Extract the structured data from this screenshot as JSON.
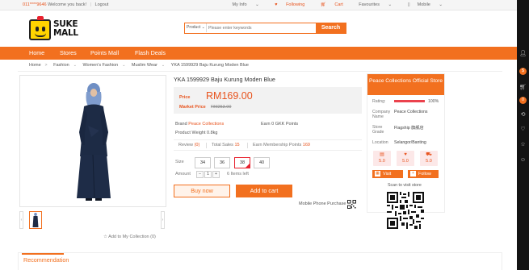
{
  "topbar": {
    "phone": "011****9646",
    "welcome": "Welcome you back!",
    "logout": "Logout",
    "my_info": "My Info",
    "following": "Following",
    "cart": "Cart",
    "favourites": "Favourites",
    "mobile": "Mobile"
  },
  "logo": {
    "line1": "SUKE",
    "line2": "MALL"
  },
  "search": {
    "category": "Product",
    "placeholder": "Please enter keywords",
    "button": "Search"
  },
  "nav": [
    "Home",
    "Stores",
    "Points Mall",
    "Flash Deals"
  ],
  "breadcrumb": [
    "Home",
    "Fashion",
    "Women's Fashion",
    "Muslim Wear",
    "YKA 1599929 Baju Kurung Moden Blue"
  ],
  "product": {
    "title": "YKA 1599929 Baju Kurung Moden Blue",
    "price_label": "Price",
    "price": "RM169.00",
    "market_label": "Market Price",
    "market_price": "RM253.00",
    "brand_label": "Brand",
    "brand": "Peace Collections",
    "points": "Earn 0 GKK Points",
    "weight": "Product Weight 0.8kg",
    "review_label": "Review",
    "review_count": "(0)",
    "sales_label": "Total Sales",
    "sales_count": "15",
    "membership_label": "Earn Membership Points",
    "membership_points": "169",
    "size_label": "Size",
    "sizes": [
      "34",
      "36",
      "38",
      "40"
    ],
    "selected_size": "38",
    "amount_label": "Amount",
    "amount": "1",
    "minus": "−",
    "plus": "+",
    "items_left": "6 Items left",
    "buy_now": "Buy now",
    "add_to_cart": "Add to cart",
    "mobile_purchase": "Mobile Phone Purchase",
    "add_collection": "Add to My Collection (0)"
  },
  "store": {
    "title": "Peace Collections Official Store",
    "rating_label": "Rating:",
    "rating": "100%",
    "company_label": "Company Name",
    "company": "Peace Collections",
    "grade_label": "Store Grade",
    "grade": "Flagship 旗舰店",
    "location_label": "Location",
    "location": "Selangor/Banting",
    "scores": [
      "5.0",
      "5.0",
      "5.0"
    ],
    "visit": "Visit",
    "follow": "Follow",
    "scan": "Scan to visit store"
  },
  "recommendation": "Recommendation",
  "colors": {
    "accent": "#f2701f",
    "price": "#e8541e",
    "sidebar": "#141414"
  },
  "sidebar_icons": [
    "user-icon",
    "coin-icon",
    "cart-icon",
    "history-icon",
    "heart-icon",
    "star-icon",
    "chat-icon"
  ],
  "sidebar_badges": [
    "0"
  ]
}
